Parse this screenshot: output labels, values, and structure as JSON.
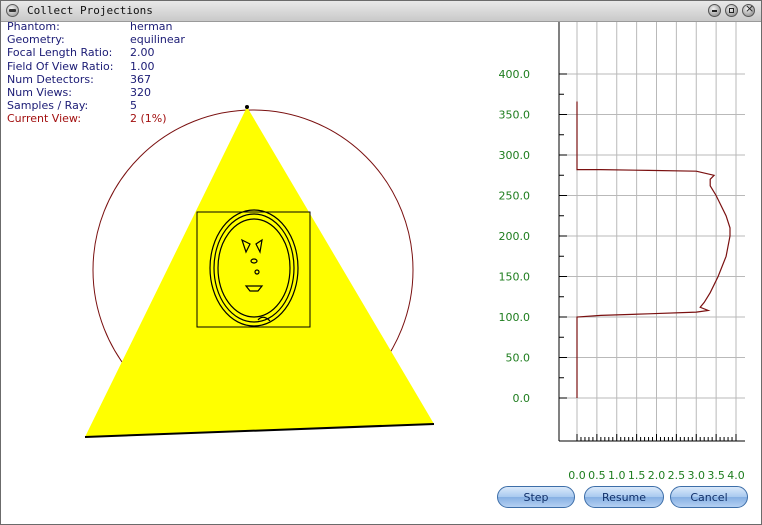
{
  "window": {
    "title": "Collect Projections"
  },
  "info": [
    {
      "label": "Phantom:",
      "value": "herman"
    },
    {
      "label": "Geometry:",
      "value": "equilinear"
    },
    {
      "label": "Focal Length Ratio:",
      "value": "2.00"
    },
    {
      "label": "Field Of View Ratio:",
      "value": "1.00"
    },
    {
      "label": "Num Detectors:",
      "value": "367"
    },
    {
      "label": "Num Views:",
      "value": "320"
    },
    {
      "label": "Samples / Ray:",
      "value": "5"
    },
    {
      "label": "Current View:",
      "value": "2 (1%)"
    }
  ],
  "buttons": {
    "step": "Step",
    "resume": "Resume",
    "cancel": "Cancel"
  },
  "colors": {
    "beam": "#ffff00",
    "circle": "#7a1010",
    "curve": "#7a1010",
    "tick_text": "#1e7d1e",
    "info_text": "#1b1b75",
    "info_highlight": "#a20f0f"
  },
  "chart_data": {
    "type": "line",
    "orientation": "vertical",
    "x_ticks": [
      "0.0",
      "0.5",
      "1.0",
      "1.5",
      "2.0",
      "2.5",
      "3.0",
      "3.5",
      "4.0"
    ],
    "y_ticks": [
      "0.0",
      "50.0",
      "100.0",
      "150.0",
      "200.0",
      "250.0",
      "300.0",
      "350.0",
      "400.0"
    ],
    "xlim": [
      0,
      4.0
    ],
    "ylim": [
      0,
      400
    ],
    "grid": true,
    "series": [
      {
        "points": [
          [
            0.0,
            0
          ],
          [
            0.0,
            50
          ],
          [
            0.0,
            92
          ],
          [
            0.0,
            100
          ],
          [
            0.6,
            102
          ],
          [
            1.8,
            104
          ],
          [
            3.0,
            106
          ],
          [
            3.3,
            108
          ],
          [
            3.1,
            112
          ],
          [
            3.2,
            118
          ],
          [
            3.35,
            130
          ],
          [
            3.55,
            150
          ],
          [
            3.75,
            175
          ],
          [
            3.85,
            200
          ],
          [
            3.85,
            210
          ],
          [
            3.75,
            225
          ],
          [
            3.5,
            250
          ],
          [
            3.35,
            262
          ],
          [
            3.35,
            270
          ],
          [
            3.45,
            275
          ],
          [
            3.0,
            280
          ],
          [
            1.8,
            281
          ],
          [
            0.6,
            282
          ],
          [
            0.0,
            282
          ],
          [
            0.0,
            300
          ],
          [
            0.0,
            366
          ]
        ]
      }
    ]
  }
}
